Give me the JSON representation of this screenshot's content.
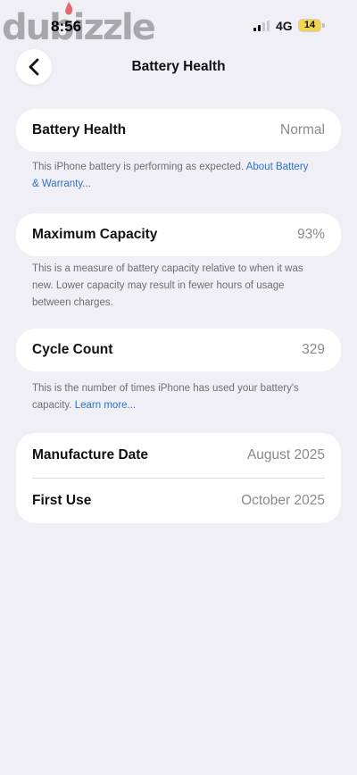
{
  "status_bar": {
    "watermark": "dubizzle",
    "time": "8:56",
    "network": "4G",
    "battery_level": "14",
    "battery_color": "#f2d54a"
  },
  "nav": {
    "back_icon": "chevron-left-icon",
    "title": "Battery Health"
  },
  "battery_health": {
    "label": "Battery Health",
    "value": "Normal",
    "note_text": "This iPhone battery is performing as expected. ",
    "note_link": "About Battery & Warranty..."
  },
  "maximum_capacity": {
    "label": "Maximum Capacity",
    "value": "93%",
    "note_text": "This is a measure of battery capacity relative to when it was new. Lower capacity may result in fewer hours of usage between charges."
  },
  "cycle_count": {
    "label": "Cycle Count",
    "value": "329",
    "note_text": "This is the number of times iPhone has used your battery's capacity. ",
    "note_link": "Learn more..."
  },
  "dates": {
    "manufacture_label": "Manufacture Date",
    "manufacture_value": "August 2025",
    "first_use_label": "First Use",
    "first_use_value": "October 2025"
  },
  "colors": {
    "background": "#f0eff6",
    "link": "#2b73c9",
    "secondary_text": "#8a8a8e"
  }
}
